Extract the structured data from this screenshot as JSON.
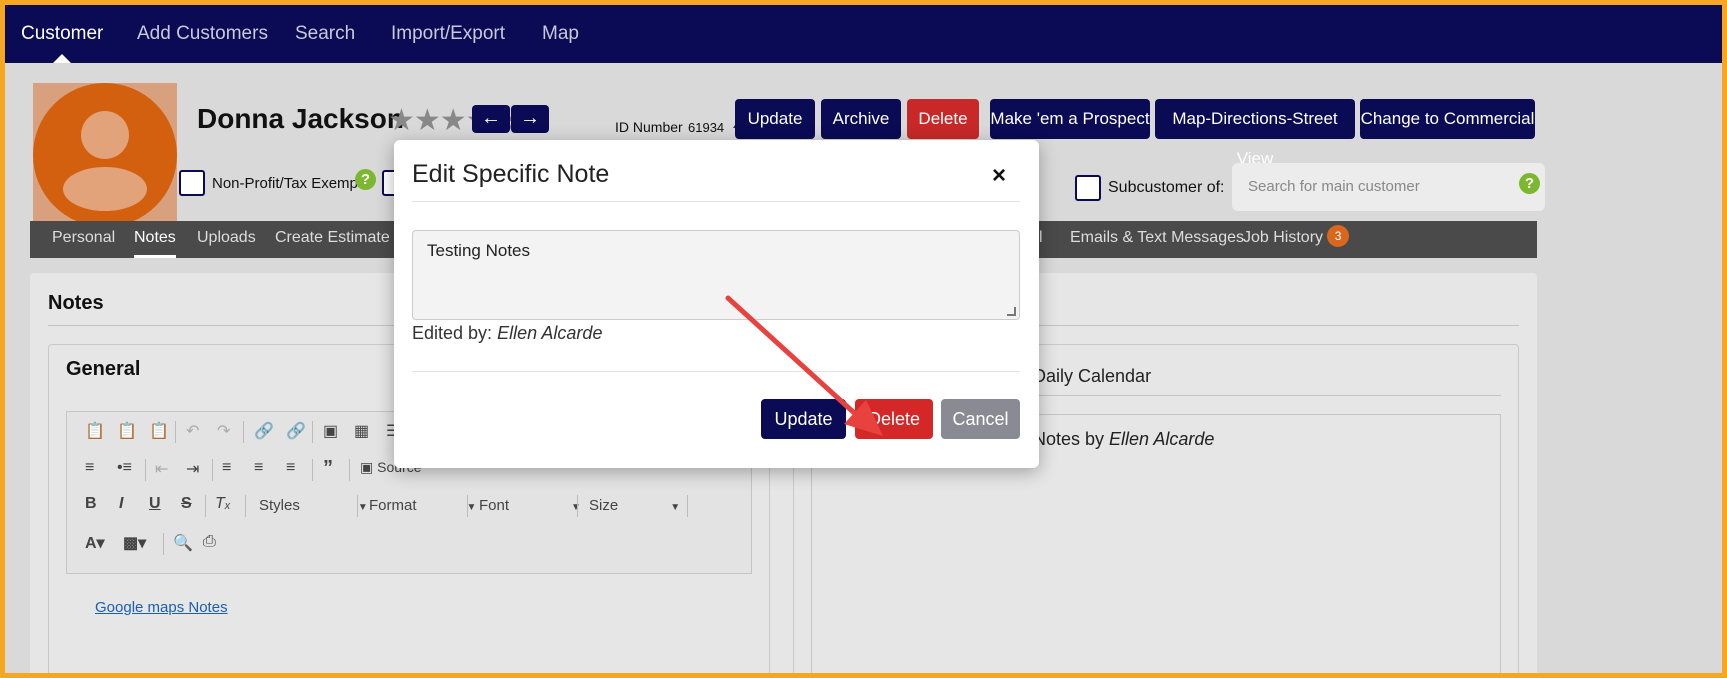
{
  "topnav": {
    "items": [
      "Customer",
      "Add Customers",
      "Search",
      "Import/Export",
      "Map"
    ]
  },
  "customer": {
    "name": "Donna Jackson",
    "rating_stars": "★★★★★",
    "id_label": "ID Number",
    "id_value": "61934"
  },
  "header_buttons": {
    "update": "Update",
    "archive": "Archive",
    "delete": "Delete",
    "prospect": "Make 'em a Prospect",
    "map": "Map-Directions-Street View",
    "commercial": "Change to Commercial"
  },
  "options": {
    "nonprofit_label": "Non-Profit/Tax Exempt",
    "subcustomer_label": "Subcustomer of:",
    "subcustomer_placeholder": "Search for main customer",
    "help_glyph": "?"
  },
  "tabs": {
    "personal": "Personal",
    "notes": "Notes",
    "uploads": "Uploads",
    "create_estimate": "Create Estimate",
    "partial_l": "l",
    "emails": "Emails & Text Messages",
    "job_history": "Job History",
    "job_history_count": "3"
  },
  "notes_section": {
    "title": "Notes",
    "general_title": "General",
    "source_label": "Source",
    "styles_label": "Styles",
    "format_label": "Format",
    "font_label": "Font",
    "size_label": "Size",
    "google_maps_link": "Google maps Notes",
    "daily_calendar_text": "n Daily Calendar",
    "note_prefix": "g Notes by ",
    "note_author": "Ellen Alcarde"
  },
  "modal": {
    "title": "Edit Specific Note",
    "close_glyph": "×",
    "note_text": "Testing Notes",
    "edited_by_label": "Edited by: ",
    "edited_by_name": "Ellen Alcarde",
    "update_label": "Update",
    "delete_label": "Delete",
    "cancel_label": "Cancel"
  },
  "colors": {
    "nav_bg": "#0a0a55",
    "danger": "#d42828",
    "annotation_arrow": "#e8423f",
    "frame_border": "#f5a623"
  }
}
